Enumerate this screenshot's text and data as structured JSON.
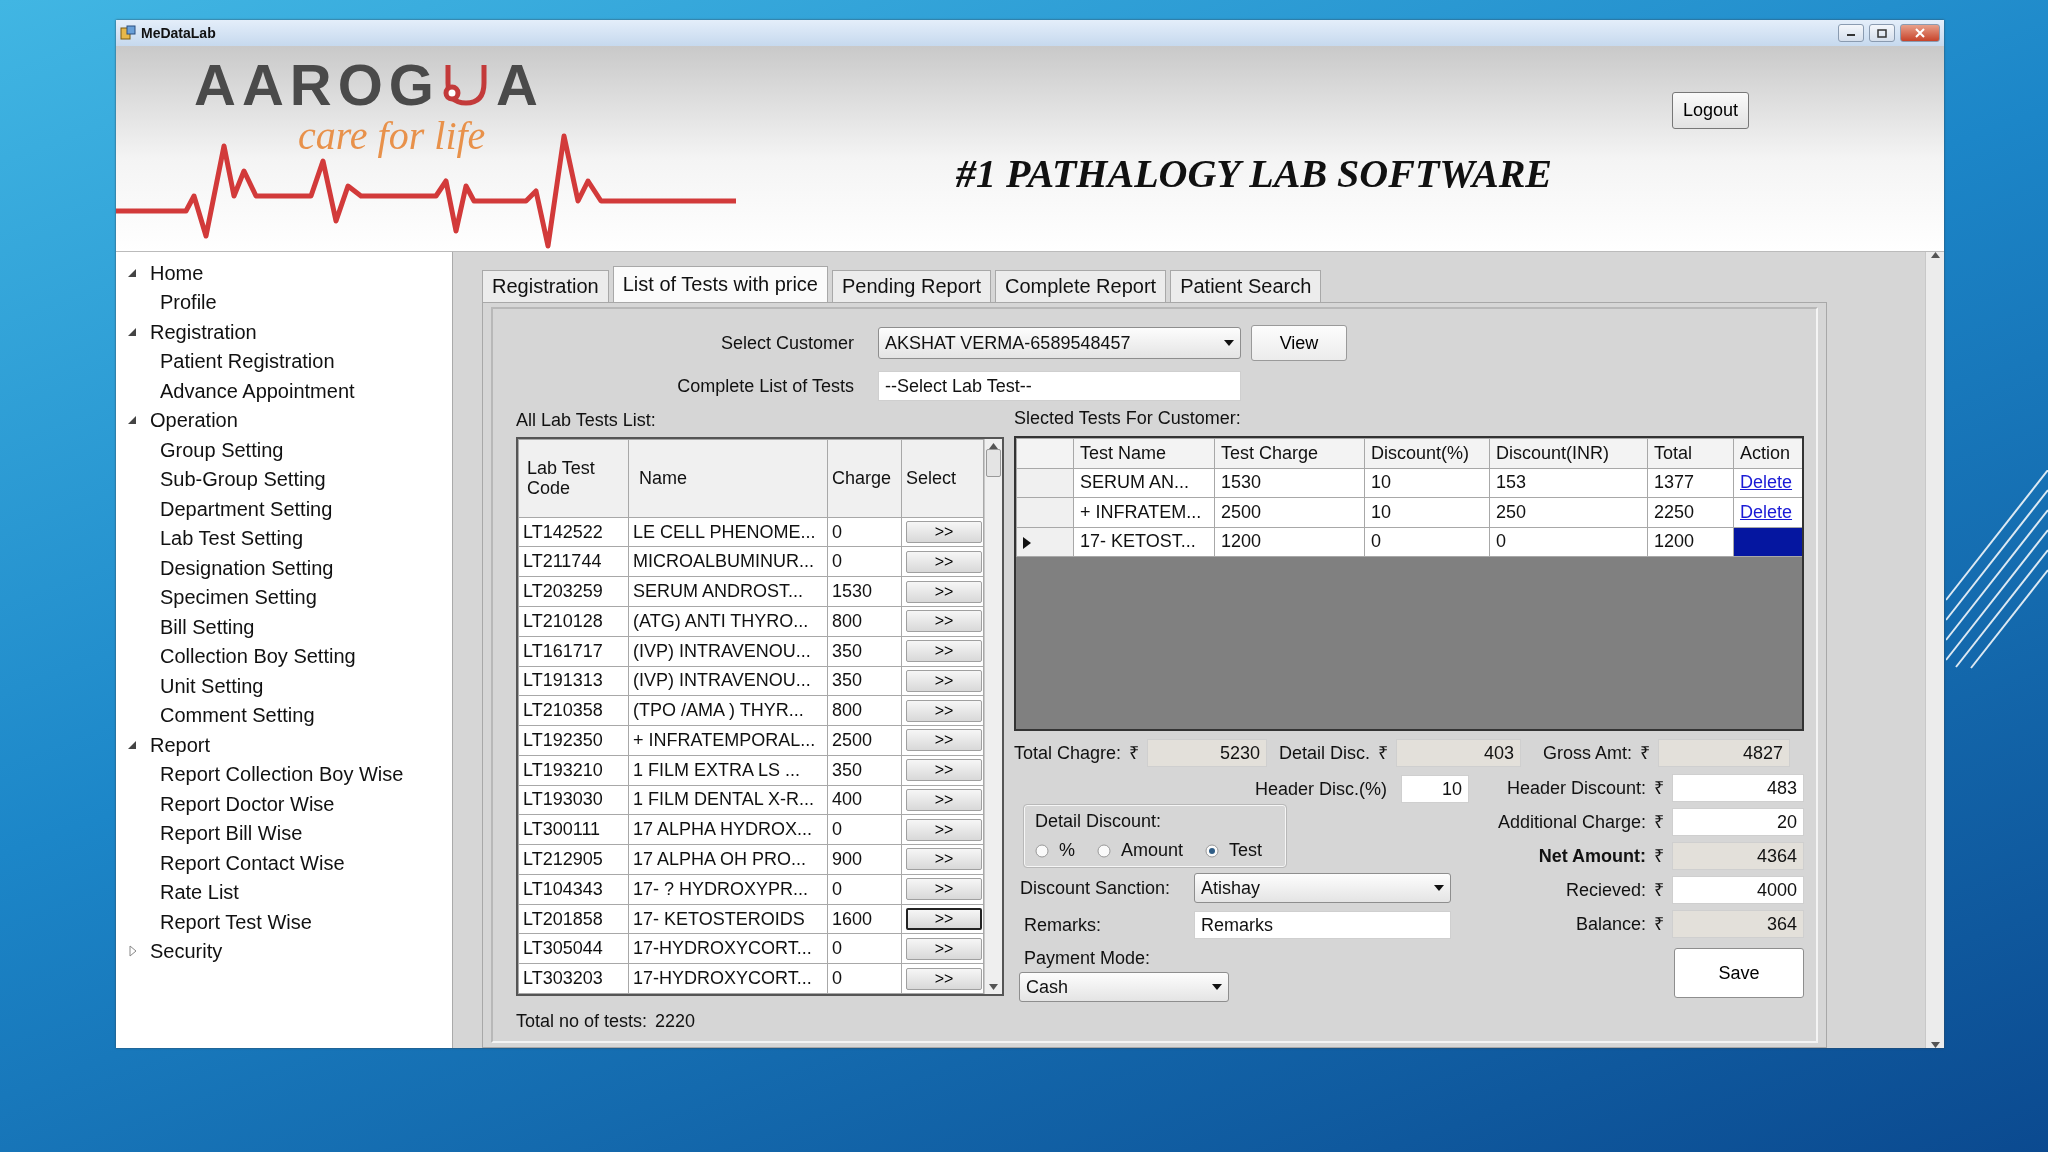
{
  "window": {
    "title": "MeDataLab"
  },
  "header": {
    "logo_start": "AAROG",
    "logo_end": "A",
    "tagline": "care for life",
    "title": "#1 PATHALOGY LAB SOFTWARE",
    "logout": "Logout"
  },
  "sidebar": {
    "items": [
      {
        "label": "Home",
        "expanded": true,
        "children": [
          {
            "label": "Profile"
          }
        ]
      },
      {
        "label": "Registration",
        "expanded": true,
        "children": [
          {
            "label": "Patient Registration"
          },
          {
            "label": "Advance Appointment"
          }
        ]
      },
      {
        "label": "Operation",
        "expanded": true,
        "children": [
          {
            "label": "Group Setting"
          },
          {
            "label": "Sub-Group Setting"
          },
          {
            "label": "Department Setting"
          },
          {
            "label": "Lab Test Setting"
          },
          {
            "label": "Designation Setting"
          },
          {
            "label": "Specimen Setting"
          },
          {
            "label": "Bill Setting"
          },
          {
            "label": "Collection Boy Setting"
          },
          {
            "label": "Unit Setting"
          },
          {
            "label": "Comment Setting"
          }
        ]
      },
      {
        "label": "Report",
        "expanded": true,
        "children": [
          {
            "label": "Report Collection Boy Wise"
          },
          {
            "label": "Report Doctor Wise"
          },
          {
            "label": "Report Bill Wise"
          },
          {
            "label": "Report Contact Wise"
          },
          {
            "label": "Rate List"
          },
          {
            "label": "Report Test Wise"
          }
        ]
      },
      {
        "label": "Security",
        "expanded": false
      }
    ]
  },
  "tabs": [
    {
      "label": "Registration",
      "selected": false
    },
    {
      "label": "List of Tests with price",
      "selected": true
    },
    {
      "label": "Pending Report",
      "selected": false
    },
    {
      "label": "Complete Report",
      "selected": false
    },
    {
      "label": "Patient Search",
      "selected": false
    }
  ],
  "customer": {
    "label": "Select Customer",
    "value": "AKSHAT VERMA-6589548457",
    "button": "View"
  },
  "test_picker": {
    "label": "Complete List of Tests",
    "value": "--Select Lab Test--"
  },
  "lab_tests": {
    "title": "All Lab Tests List:",
    "columns": [
      "Lab Test Code",
      "Name",
      "Charge",
      "Select"
    ],
    "rows": [
      {
        "code": "LT142522",
        "name": "LE CELL PHENOME...",
        "charge": "0",
        "button": ">>",
        "focused": false
      },
      {
        "code": "LT211744",
        "name": "MICROALBUMINUR...",
        "charge": "0",
        "button": ">>",
        "focused": false
      },
      {
        "code": "LT203259",
        "name": "SERUM ANDROST...",
        "charge": "1530",
        "button": ">>",
        "focused": false
      },
      {
        "code": "LT210128",
        "name": "(ATG) ANTI THYRO...",
        "charge": "800",
        "button": ">>",
        "focused": false
      },
      {
        "code": "LT161717",
        "name": "(IVP) INTRAVENOU...",
        "charge": "350",
        "button": ">>",
        "focused": false
      },
      {
        "code": "LT191313",
        "name": "(IVP) INTRAVENOU...",
        "charge": "350",
        "button": ">>",
        "focused": false
      },
      {
        "code": "LT210358",
        "name": "(TPO /AMA ) THYR...",
        "charge": "800",
        "button": ">>",
        "focused": false
      },
      {
        "code": "LT192350",
        "name": "+ INFRATEMPORAL...",
        "charge": "2500",
        "button": ">>",
        "focused": false
      },
      {
        "code": "LT193210",
        "name": "1  FILM EXTRA  LS ...",
        "charge": "350",
        "button": ">>",
        "focused": false
      },
      {
        "code": "LT193030",
        "name": "1 FILM DENTAL X-R...",
        "charge": "400",
        "button": ">>",
        "focused": false
      },
      {
        "code": "LT300111",
        "name": "17 ALPHA HYDROX...",
        "charge": "0",
        "button": ">>",
        "focused": false
      },
      {
        "code": "LT212905",
        "name": "17 ALPHA OH PRO...",
        "charge": "900",
        "button": ">>",
        "focused": false
      },
      {
        "code": "LT104343",
        "name": "17- ? HYDROXYPR...",
        "charge": "0",
        "button": ">>",
        "focused": false
      },
      {
        "code": "LT201858",
        "name": "17- KETOSTEROIDS",
        "charge": "1600",
        "button": ">>",
        "focused": true
      },
      {
        "code": "LT305044",
        "name": "17-HYDROXYCORT...",
        "charge": "0",
        "button": ">>",
        "focused": false
      },
      {
        "code": "LT303203",
        "name": "17-HYDROXYCORT...",
        "charge": "0",
        "button": ">>",
        "focused": false
      }
    ],
    "total_label": "Total no of tests:",
    "total": "2220"
  },
  "selected_tests": {
    "title": "Slected Tests For Customer:",
    "columns": [
      "Test Name",
      "Test Charge",
      "Discount(%)",
      "Discount(INR)",
      "Total",
      "Action"
    ],
    "rows": [
      {
        "current": false,
        "name": "SERUM AN...",
        "charge": "1530",
        "discount_pct": "10",
        "discount_inr": "153",
        "total": "1377",
        "action": "Delete"
      },
      {
        "current": false,
        "name": "+ INFRATEM...",
        "charge": "2500",
        "discount_pct": "10",
        "discount_inr": "250",
        "total": "2250",
        "action": "Delete"
      },
      {
        "current": true,
        "name": "17- KETOST...",
        "charge": "1200",
        "discount_pct": "0",
        "discount_inr": "0",
        "total": "1200"
      }
    ]
  },
  "totals_row": [
    {
      "label": "Total Chagre:",
      "currency": "₹",
      "value": "5230",
      "readonly": true
    },
    {
      "label": "Detail Disc.",
      "currency": "₹",
      "value": "403",
      "readonly": true
    },
    {
      "label": "Gross Amt:",
      "currency": "₹",
      "value": "4827",
      "readonly": true
    }
  ],
  "header_disc": {
    "label": "Header Disc.(%)",
    "value": "10"
  },
  "detail_discount": {
    "title": "Detail Discount:",
    "options": [
      {
        "label": "%",
        "selected": false
      },
      {
        "label": "Amount",
        "selected": false
      },
      {
        "label": "Test",
        "selected": true
      }
    ]
  },
  "discount_sanction": {
    "label": "Discount Sanction:",
    "value": "Atishay"
  },
  "remarks": {
    "label": "Remarks:",
    "value": "Remarks"
  },
  "payment_mode": {
    "label": "Payment Mode:",
    "value": "Cash"
  },
  "amounts": [
    {
      "label": "Header Discount:",
      "currency": "₹",
      "value": "483",
      "readonly": false,
      "bold": false
    },
    {
      "label": "Additional Charge:",
      "currency": "₹",
      "value": "20",
      "readonly": false,
      "bold": false
    },
    {
      "label": "Net Amount:",
      "currency": "₹",
      "value": "4364",
      "readonly": true,
      "bold": true
    },
    {
      "label": "Recieved:",
      "currency": "₹",
      "value": "4000",
      "readonly": false,
      "bold": false
    },
    {
      "label": "Balance:",
      "currency": "₹",
      "value": "364",
      "readonly": true,
      "bold": false
    }
  ],
  "save": "Save"
}
